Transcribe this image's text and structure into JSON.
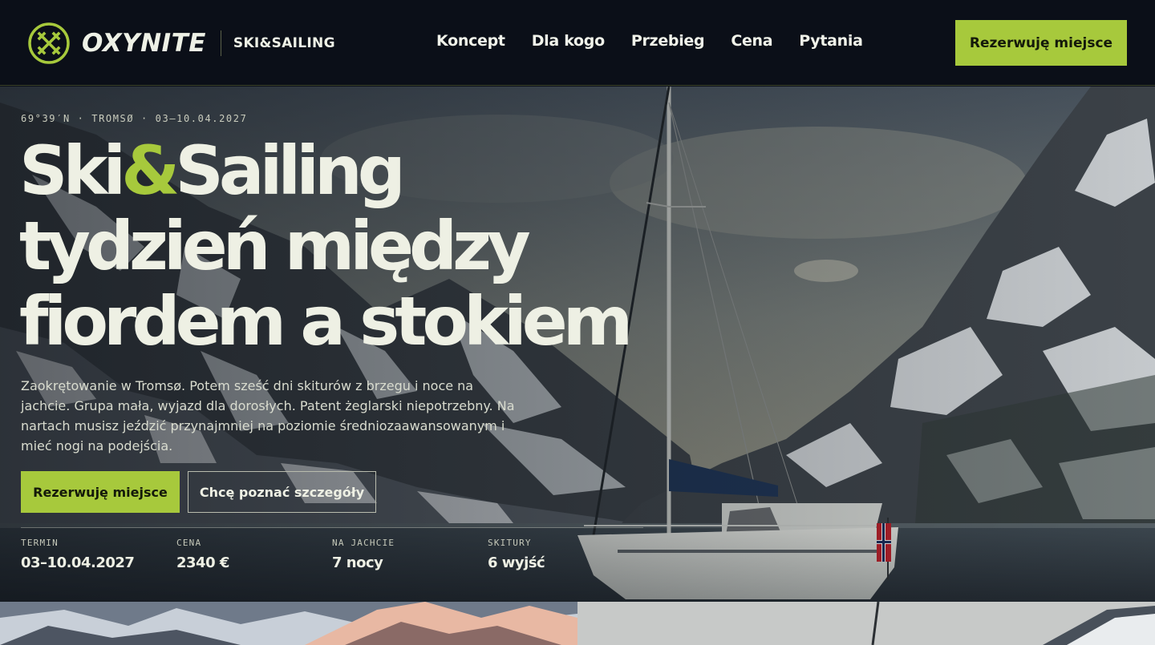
{
  "nav": {
    "brand_name": "OXYNITE",
    "brand_sub": "SKI&SAILING",
    "links": [
      "Koncept",
      "Dla kogo",
      "Przebieg",
      "Cena",
      "Pytania"
    ],
    "cta": "Rezerwuję miejsce"
  },
  "hero": {
    "eyebrow": "69°39′N · TROMSØ · 03–10.04.2027",
    "headline_part1": "Ski",
    "headline_amp": "&",
    "headline_part2": "Sailing",
    "headline_line2": "tydzień między",
    "headline_line3": "fiordem a stokiem",
    "lead": "Zaokrętowanie w Tromsø. Potem sześć dni skiturów z brzegu i noce na jachcie. Grupa mała, wyjazd dla dorosłych. Patent żeglarski niepotrzebny. Na nartach musisz jeździć przynajmniej na poziomie średniozaawansowanym i mieć nogi na podejścia.",
    "primary_cta": "Rezerwuję miejsce",
    "secondary_cta": "Chcę poznać szczegóły",
    "facts": [
      {
        "label": "TERMIN",
        "value": "03–10.04.2027"
      },
      {
        "label": "CENA",
        "value": "2340 €"
      },
      {
        "label": "NA JACHCIE",
        "value": "7 nocy"
      },
      {
        "label": "SKITURY",
        "value": "6 wyjść"
      }
    ]
  },
  "colors": {
    "accent": "#a7c93c",
    "nav_bg": "#0b0f18",
    "text_light": "#eef0e4"
  },
  "icons": {
    "logo": "oxynite-logo-icon",
    "flag": "norway-flag-icon"
  }
}
